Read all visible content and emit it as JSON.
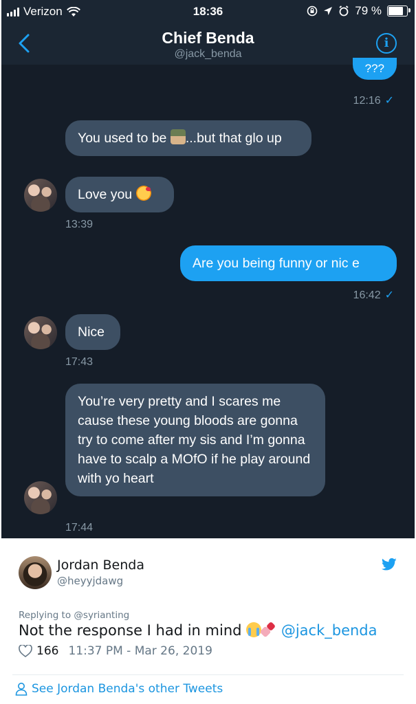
{
  "status_bar": {
    "carrier": "Verizon",
    "time": "18:36",
    "battery": "79 %",
    "battery_level": 0.79
  },
  "nav": {
    "title": "Chief Benda",
    "handle": "@jack_benda"
  },
  "messages": {
    "m0": {
      "text": "???",
      "time": "12:16"
    },
    "m1": {
      "text_a": "You used to be ",
      "text_b": "...but that glo up"
    },
    "m2": {
      "text": "Love you ",
      "time": "13:39"
    },
    "m3": {
      "text": "Are you being funny or nic e",
      "time": "16:42"
    },
    "m4": {
      "text": "Nice",
      "time": "17:43"
    },
    "m5": {
      "text": "You’re very pretty and I scares me cause these young bloods are gonna try to come after my sis and I’m gonna have to scalp a MOfO if he play around with yo heart",
      "time": "17:44"
    }
  },
  "tweet": {
    "name": "Jordan Benda",
    "handle": "@heyyjdawg",
    "reply_prefix": "Replying to ",
    "reply_to": "@syrianting",
    "text": "Not the response I had in mind ",
    "mention": "@jack_benda",
    "likes": "166",
    "timestamp": "11:37 PM - Mar 26, 2019",
    "more_link": "See Jordan Benda's other Tweets"
  },
  "colors": {
    "chat_bg": "#151d28",
    "incoming_bubble": "#3d4f63",
    "outgoing_bubble": "#1da1f2",
    "twitter_blue": "#1b95e0"
  }
}
